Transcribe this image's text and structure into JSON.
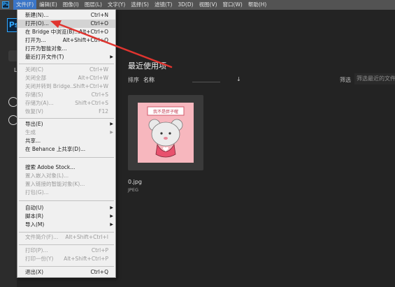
{
  "menubar": {
    "app_icon": "Ps",
    "items": [
      "文件(F)",
      "编辑(E)",
      "图像(I)",
      "图层(L)",
      "文字(Y)",
      "选择(S)",
      "滤镜(T)",
      "3D(D)",
      "视图(V)",
      "窗口(W)",
      "帮助(H)"
    ]
  },
  "logo": "Ps",
  "home": {
    "recent_title": "最近使用项",
    "sort_label": "排序",
    "sort_value": "名称",
    "sort_direction_icon": "arrow-down-icon",
    "filter_label": "筛选",
    "filter_placeholder": "筛选最近的文件",
    "stub_letter": "L",
    "recent_files": [
      {
        "name": "0.jpg",
        "type": "JPEG",
        "thumb_text": "我不是胖子喔"
      }
    ]
  },
  "file_menu": {
    "items": [
      {
        "label": "新建(N)...",
        "shortcut": "Ctrl+N"
      },
      {
        "label": "打开(O)...",
        "shortcut": "Ctrl+O"
      },
      {
        "label": "在 Bridge 中浏览(B)...",
        "shortcut": "Alt+Ctrl+O"
      },
      {
        "label": "打开为...",
        "shortcut": "Alt+Shift+Ctrl+O"
      },
      {
        "label": "打开为智能对象...",
        "shortcut": ""
      },
      {
        "label": "最近打开文件(T)",
        "shortcut": ""
      },
      {
        "label": "关闭(C)",
        "shortcut": "Ctrl+W"
      },
      {
        "label": "关闭全部",
        "shortcut": "Alt+Ctrl+W"
      },
      {
        "label": "关闭并转到 Bridge...",
        "shortcut": "Shift+Ctrl+W"
      },
      {
        "label": "存储(S)",
        "shortcut": "Ctrl+S"
      },
      {
        "label": "存储为(A)...",
        "shortcut": "Shift+Ctrl+S"
      },
      {
        "label": "恢复(V)",
        "shortcut": "F12"
      },
      {
        "label": "导出(E)",
        "shortcut": ""
      },
      {
        "label": "生成",
        "shortcut": ""
      },
      {
        "label": "共享...",
        "shortcut": ""
      },
      {
        "label": "在 Behance 上共享(D)...",
        "shortcut": ""
      },
      {
        "label": "搜索 Adobe Stock...",
        "shortcut": ""
      },
      {
        "label": "置入嵌入对象(L)...",
        "shortcut": ""
      },
      {
        "label": "置入链接的智能对象(K)...",
        "shortcut": ""
      },
      {
        "label": "打包(G)...",
        "shortcut": ""
      },
      {
        "label": "自动(U)",
        "shortcut": ""
      },
      {
        "label": "脚本(R)",
        "shortcut": ""
      },
      {
        "label": "导入(M)",
        "shortcut": ""
      },
      {
        "label": "文件简介(F)...",
        "shortcut": "Alt+Shift+Ctrl+I"
      },
      {
        "label": "打印(P)...",
        "shortcut": "Ctrl+P"
      },
      {
        "label": "打印一份(Y)",
        "shortcut": "Alt+Shift+Ctrl+P"
      },
      {
        "label": "退出(X)",
        "shortcut": "Ctrl+Q"
      }
    ]
  },
  "colors": {
    "ps_blue": "#31a8ff",
    "menu_highlight": "#3b76c8",
    "annotation_arrow": "#e0342f",
    "thumbnail_pink": "#f7b7be"
  }
}
